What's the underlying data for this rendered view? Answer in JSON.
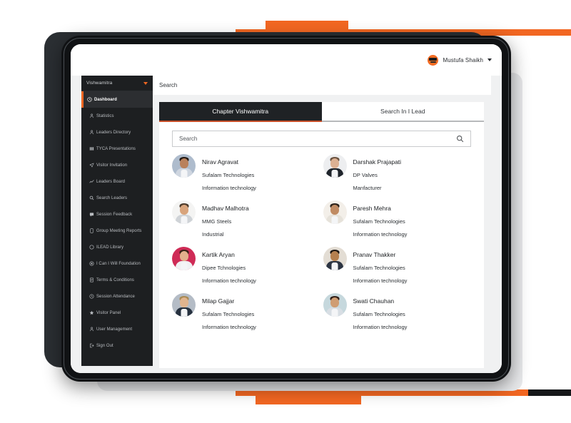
{
  "brand": {
    "accent": "#f26722",
    "tab_underline": "#c8502a",
    "sidebar_bg": "#1d1f21",
    "active_bg": "#2c2e31"
  },
  "topbar": {
    "user_name": "Mustufa Shaikh",
    "avatar_icon": "logo-badge-icon",
    "caret_icon": "chevron-down-icon"
  },
  "sidebar": {
    "chapter": "Vishwamitra",
    "chapter_caret_icon": "caret-down-icon",
    "items": [
      {
        "label": "Dashboard",
        "icon": "dashboard-icon",
        "active": true
      },
      {
        "label": "Statistics",
        "icon": "statistics-icon",
        "active": false
      },
      {
        "label": "Leaders Directory",
        "icon": "directory-icon",
        "active": false
      },
      {
        "label": "TYCA Presentations",
        "icon": "presentation-icon",
        "active": false
      },
      {
        "label": "Visitor Invitation",
        "icon": "send-icon",
        "active": false
      },
      {
        "label": "Leaders Board",
        "icon": "chart-line-icon",
        "active": false
      },
      {
        "label": "Search Leaders",
        "icon": "search-icon",
        "active": false
      },
      {
        "label": "Session Feedback",
        "icon": "feedback-icon",
        "active": false
      },
      {
        "label": "Group Meeting Reports",
        "icon": "report-icon",
        "active": false
      },
      {
        "label": "ILEAD Library",
        "icon": "library-icon",
        "active": false
      },
      {
        "label": "I Can I Will Foundation",
        "icon": "foundation-icon",
        "active": false
      },
      {
        "label": "Terms & Conditions",
        "icon": "document-icon",
        "active": false
      },
      {
        "label": "Session Attendance",
        "icon": "clock-icon",
        "active": false
      },
      {
        "label": "Visitor Panel",
        "icon": "star-icon",
        "active": false
      },
      {
        "label": "User Management",
        "icon": "user-icon",
        "active": false
      },
      {
        "label": "Sign Out",
        "icon": "sign-out-icon",
        "active": false
      }
    ]
  },
  "page": {
    "title": "Search"
  },
  "tabs": [
    {
      "label": "Chapter Vishwamitra",
      "active": true
    },
    {
      "label": "Search In I Lead",
      "active": false
    }
  ],
  "search": {
    "placeholder": "Search",
    "value": "",
    "icon": "search-icon"
  },
  "contacts": [
    {
      "name": "Nirav Agravat",
      "company": "Sufalam Technologies",
      "industry": "Information technology",
      "avatar": {
        "bg": "#aebccd",
        "skin": "#b9815c",
        "hair": "#241a14",
        "body": "#cfd6e0"
      }
    },
    {
      "name": "Darshak Prajapati",
      "company": "DP Valves",
      "industry": "Manfacturer",
      "avatar": {
        "bg": "#edeef0",
        "skin": "#ddb193",
        "hair": "#6b5340",
        "body": "#1f242b"
      }
    },
    {
      "name": "Madhav Malhotra",
      "company": "MMG Steels",
      "industry": "Industrial",
      "avatar": {
        "bg": "#f4f4f3",
        "skin": "#d8a47c",
        "hair": "#4b3a2b",
        "body": "#cfd3d7"
      }
    },
    {
      "name": "Paresh Mehra",
      "company": "Sufalam Technologies",
      "industry": "Information technology",
      "avatar": {
        "bg": "#f3efe9",
        "skin": "#c08b63",
        "hair": "#2b2119",
        "body": "#e6e2da"
      }
    },
    {
      "name": "Kartik Aryan",
      "company": "Dipee Tchnologies",
      "industry": "Information technology",
      "avatar": {
        "bg": "#cf2b56",
        "skin": "#e2b08c",
        "hair": "#3a2419",
        "body": "#f0f1f3"
      }
    },
    {
      "name": "Pranav Thakker",
      "company": "Sufalam Technologies",
      "industry": "Information technology",
      "avatar": {
        "bg": "#e3ddd4",
        "skin": "#b5804f",
        "hair": "#1d1713",
        "body": "#2c3442"
      }
    },
    {
      "name": "Milap Gajjar",
      "company": "Sufalam Technologies",
      "industry": "Information technology",
      "avatar": {
        "bg": "#b4bcc6",
        "skin": "#e0b48e",
        "hair": "#a98a53",
        "body": "#26313f"
      }
    },
    {
      "name": "Swati Chauhan",
      "company": "Sufalam Technologies",
      "industry": "Information technology",
      "avatar": {
        "bg": "#c6d8dd",
        "skin": "#cf9d73",
        "hair": "#332018",
        "body": "#d8dee4"
      }
    }
  ]
}
